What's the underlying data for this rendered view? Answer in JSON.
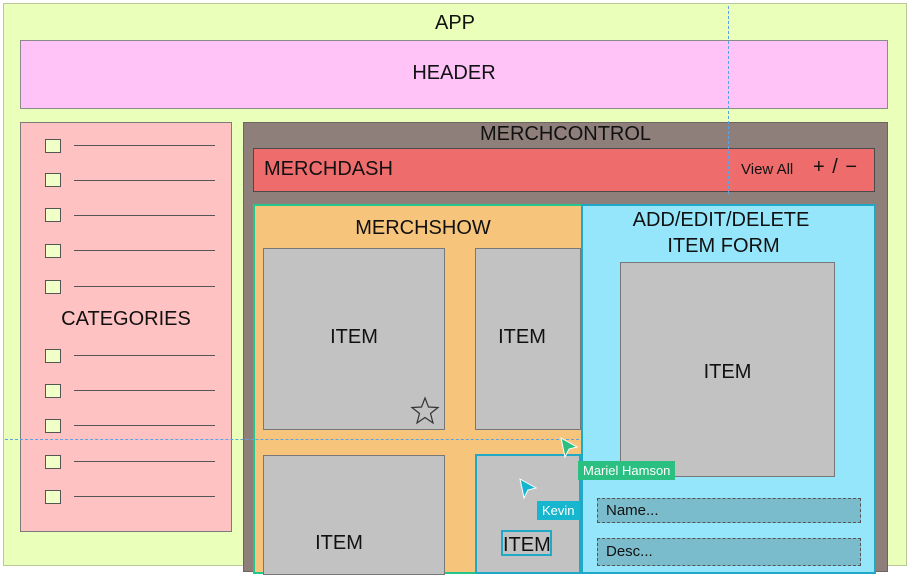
{
  "app": {
    "title": "APP"
  },
  "header": {
    "title": "HEADER"
  },
  "categories": {
    "title": "CATEGORIES"
  },
  "merchcontrol": {
    "title": "MERCHCONTROL"
  },
  "merchdash": {
    "title": "MERCHDASH",
    "view_all": "View All",
    "add_remove": "+ / −"
  },
  "merchshow": {
    "title": "MERCHSHOW",
    "items": [
      "ITEM",
      "ITEM",
      "ITEM",
      "ITEM"
    ]
  },
  "form": {
    "title_line1": "ADD/EDIT/DELETE",
    "title_line2": "ITEM FORM",
    "item_label": "ITEM",
    "name_placeholder": "Name...",
    "desc_placeholder": "Desc..."
  },
  "collaborators": [
    {
      "name": "Mariel Hamson",
      "color": "#2bbf82"
    },
    {
      "name": "Kevin",
      "color": "#17b6cf"
    }
  ],
  "icons": {
    "favorite": "star-icon",
    "cursor": "cursor-arrow-icon"
  }
}
